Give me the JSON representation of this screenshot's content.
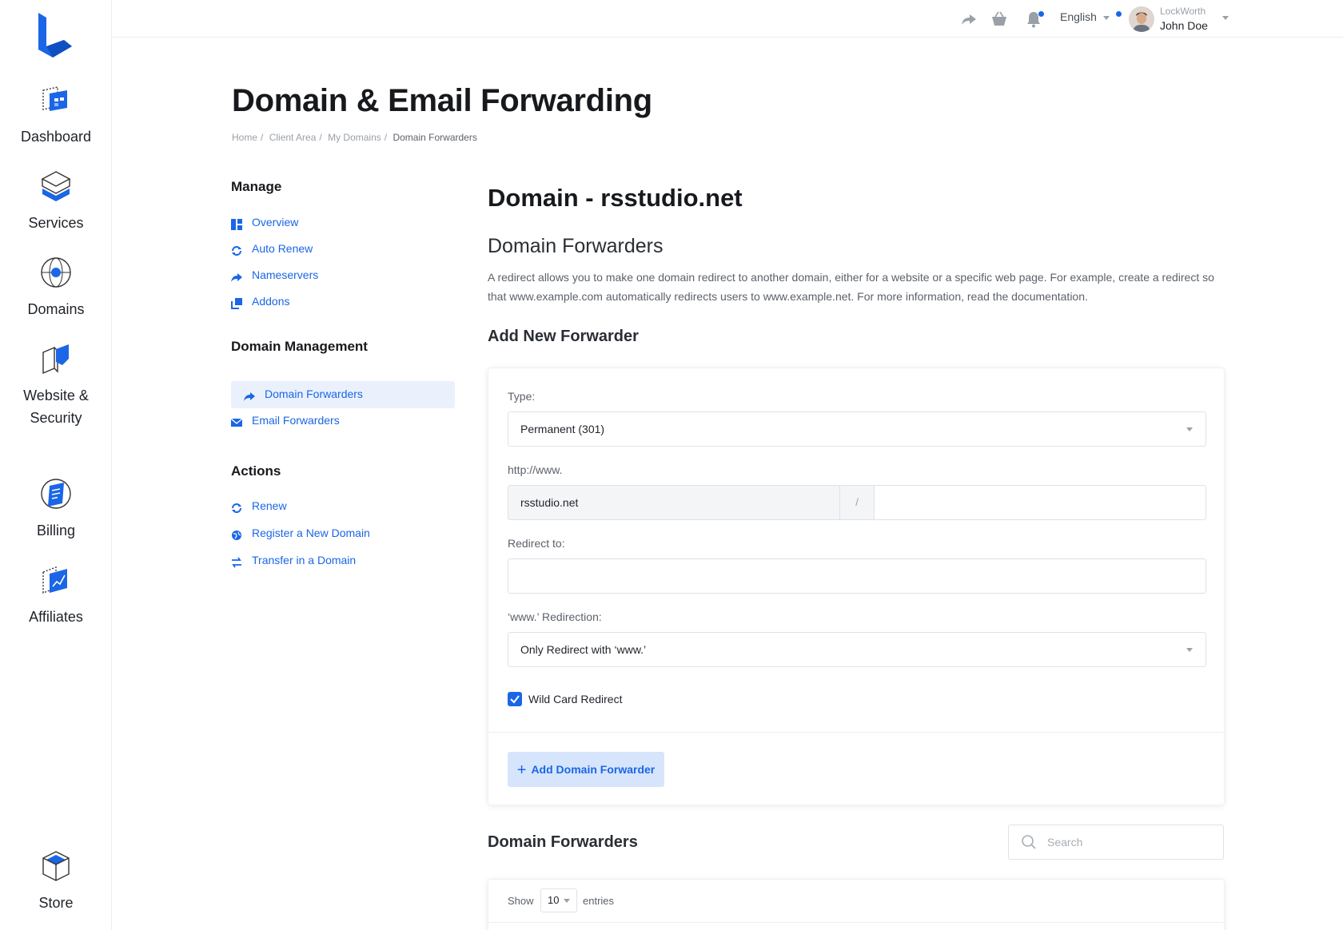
{
  "app_nav": {
    "items": [
      {
        "label": "Dashboard"
      },
      {
        "label": "Services"
      },
      {
        "label": "Domains"
      },
      {
        "label": "Website &\nSecurity"
      },
      {
        "label": "Billing"
      },
      {
        "label": "Affiliates"
      },
      {
        "label": "Store"
      }
    ]
  },
  "topbar": {
    "language": "English",
    "user_company": "LockWorth",
    "user_name": "John Doe"
  },
  "page": {
    "title": "Domain & Email Forwarding",
    "breadcrumb": [
      "Home",
      "Client Area",
      "My Domains",
      "Domain Forwarders"
    ]
  },
  "side_menu": {
    "manage_heading": "Manage",
    "manage_items": [
      "Overview",
      "Auto Renew",
      "Nameservers",
      "Addons"
    ],
    "domain_mgmt_heading": "Domain Management",
    "domain_mgmt_items": [
      "Domain Forwarders",
      "Email Forwarders"
    ],
    "actions_heading": "Actions",
    "actions_items": [
      "Renew",
      "Register a New Domain",
      "Transfer in a Domain"
    ]
  },
  "main": {
    "domain_heading": "Domain - rsstudio.net",
    "section_heading": "Domain Forwarders",
    "description": "A redirect allows you to make one domain redirect to another domain, either for a website or a specific web page. For example, create a redirect so that www.example.com automatically redirects users to www.example.net. For more information, read the documentation.",
    "add_heading": "Add New Forwarder",
    "form": {
      "type_label": "Type:",
      "type_value": "Permanent (301)",
      "source_label": "http://www.",
      "source_domain": "rsstudio.net",
      "source_separator": "/",
      "source_path": "",
      "redirect_label": "Redirect to:",
      "redirect_value": "",
      "www_label": "‘www.’ Redirection:",
      "www_value": "Only Redirect with ‘www.’",
      "wildcard_label": "Wild Card Redirect",
      "wildcard_checked": true,
      "submit_label": "Add Domain Forwarder"
    },
    "list_heading": "Domain Forwarders",
    "search_placeholder": "Search",
    "table": {
      "show_label": "Show",
      "page_size": "10",
      "entries_label": "entries"
    }
  },
  "colors": {
    "accent": "#1a66e6",
    "active_bg": "#eaf1fd",
    "button_bg": "#d6e5fb"
  }
}
